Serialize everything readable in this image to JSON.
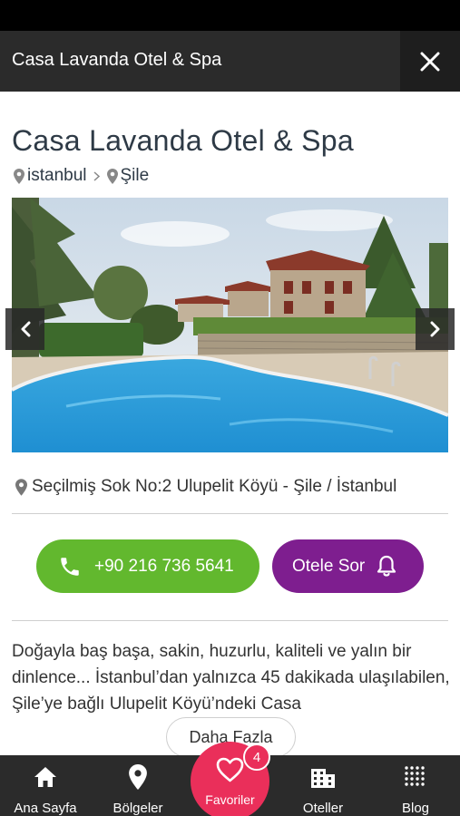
{
  "header": {
    "title": "Casa Lavanda Otel & Spa",
    "close_icon": "close-icon"
  },
  "hotel": {
    "name": "Casa Lavanda Otel & Spa",
    "breadcrumb": [
      {
        "label": "istanbul"
      },
      {
        "label": "Şile"
      }
    ],
    "address": "Seçilmiş Sok No:2 Ulupelit Köyü - Şile / İstanbul",
    "description": "Doğayla baş başa, sakin, huzurlu, kaliteli ve yalın bir dinlence... İstanbul’dan yalnızca 45 dakikada ulaşılabilen, Şile’ye bağlı Ulupelit Köyü’ndeki Casa"
  },
  "actions": {
    "phone_label": "+90 216 736 5641",
    "ask_label": "Otele Sor",
    "more_label": "Daha Fazla"
  },
  "bottom_nav": {
    "home": "Ana Sayfa",
    "regions": "Bölgeler",
    "favorites": "Favoriler",
    "favorites_count": "4",
    "hotels": "Oteller",
    "blog": "Blog"
  },
  "colors": {
    "header_bg": "#2b2b2b",
    "call_button": "#62b82e",
    "ask_button": "#7e1e8f",
    "favorites_accent": "#ea2f5a",
    "title_text": "#2e3a46"
  }
}
